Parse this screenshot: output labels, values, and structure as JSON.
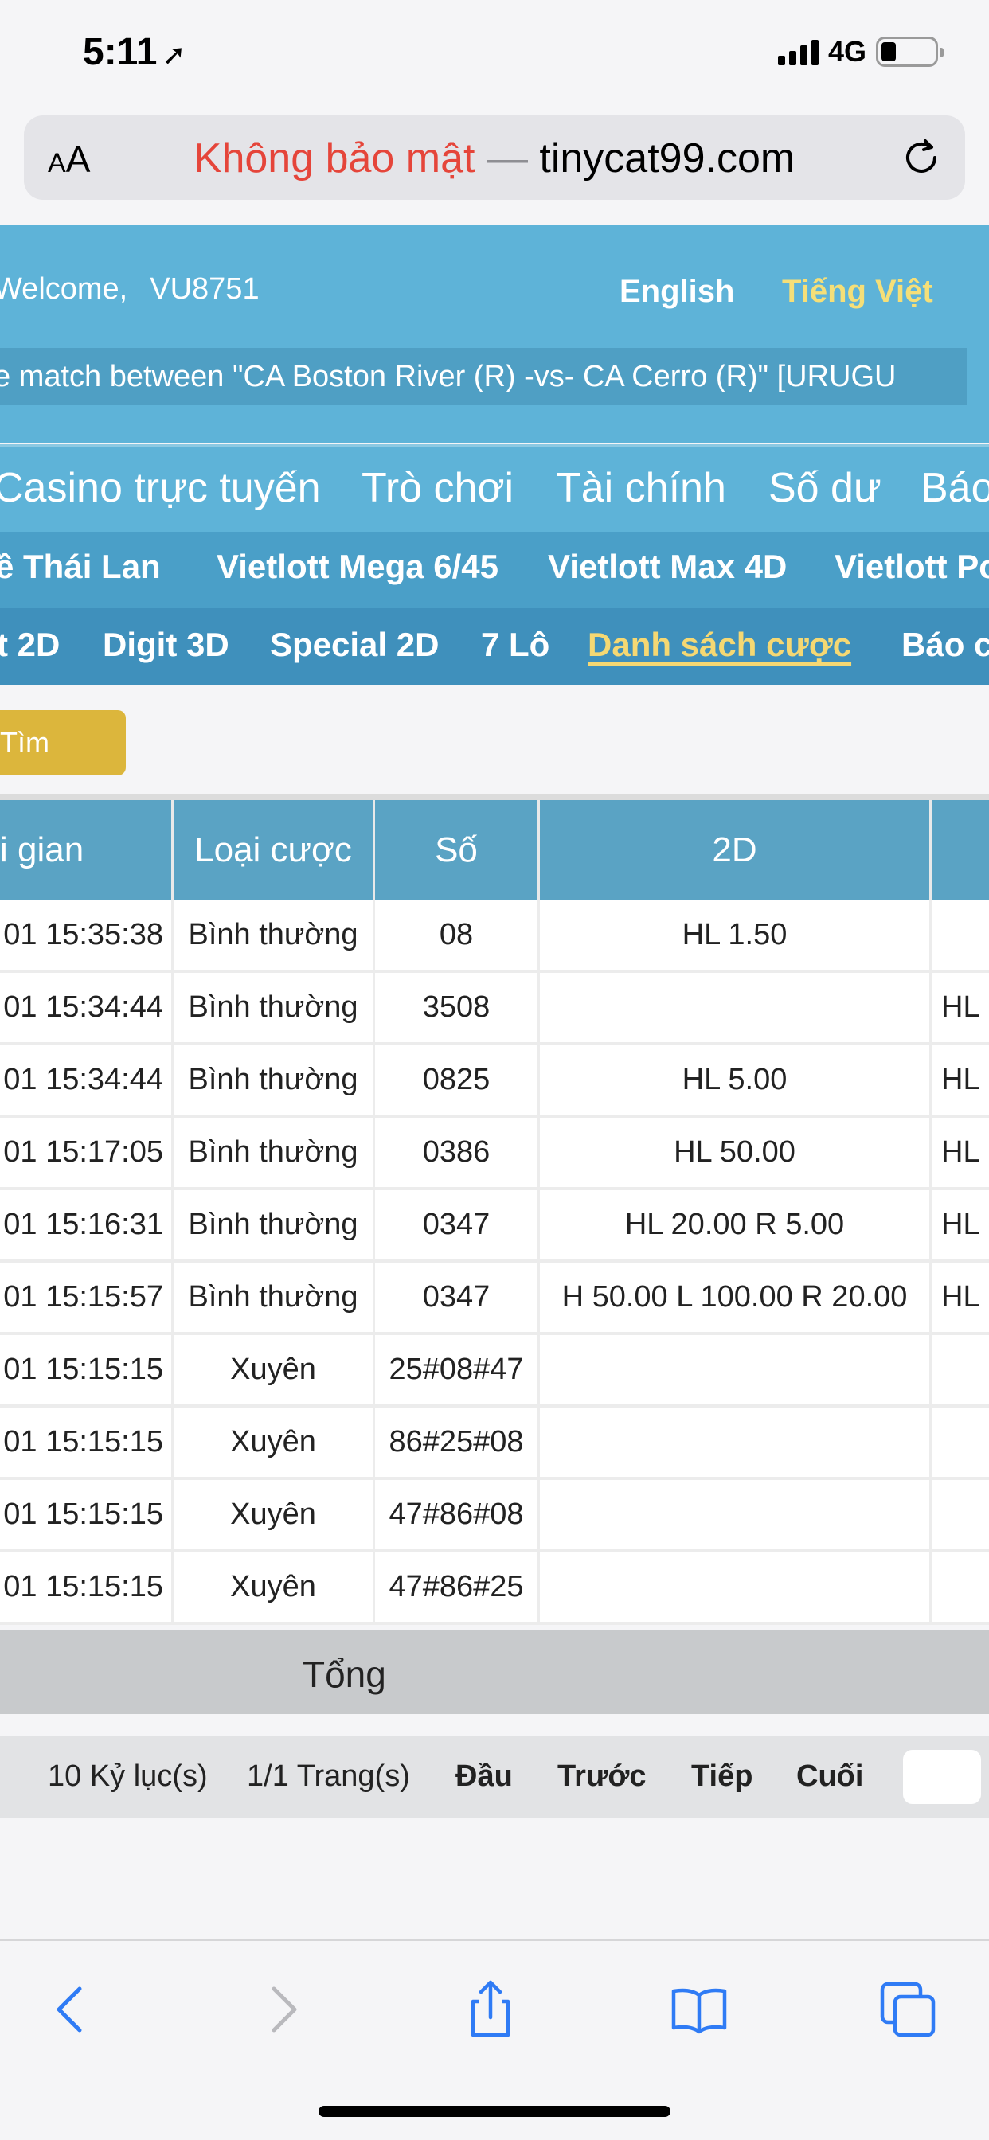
{
  "status_bar": {
    "time": "5:11",
    "network": "4G"
  },
  "browser": {
    "aa_label_small": "A",
    "aa_label_big": "A",
    "url_insecure": "Không bảo mật",
    "url_dash": "—",
    "url_domain": "tinycat99.com"
  },
  "header": {
    "welcome_label": "Welcome,",
    "user_id": "VU8751",
    "lang_en": "English",
    "lang_vi": "Tiếng Việt",
    "marquee": "e match between \"CA Boston River (R) -vs- CA Cerro (R)\" [URUGU"
  },
  "menu_main": [
    "Casino trực tuyến",
    "Trò chơi",
    "Tài chính",
    "Số dư",
    "Báo"
  ],
  "menu_lottery": [
    "ề Thái Lan",
    "Vietlott Mega 6/45",
    "Vietlott Max 4D",
    "Vietlott Po"
  ],
  "menu_sub": [
    "t 2D",
    "Digit 3D",
    "Special 2D",
    "7 Lô",
    "Danh sách cược",
    "Báo c"
  ],
  "search_button": "Tìm",
  "table": {
    "headers": [
      "i gian",
      "Loại cược",
      "Số",
      "2D",
      ""
    ],
    "rows": [
      {
        "time": "01 15:35:38",
        "type": "Bình thường",
        "number": "08",
        "d2": "HL 1.50",
        "extra": ""
      },
      {
        "time": "01 15:34:44",
        "type": "Bình thường",
        "number": "3508",
        "d2": "",
        "extra": "HL"
      },
      {
        "time": "01 15:34:44",
        "type": "Bình thường",
        "number": "0825",
        "d2": "HL 5.00",
        "extra": "HL"
      },
      {
        "time": "01 15:17:05",
        "type": "Bình thường",
        "number": "0386",
        "d2": "HL 50.00",
        "extra": "HL"
      },
      {
        "time": "01 15:16:31",
        "type": "Bình thường",
        "number": "0347",
        "d2": "HL 20.00 R 5.00",
        "extra": "HL"
      },
      {
        "time": "01 15:15:57",
        "type": "Bình thường",
        "number": "0347",
        "d2": "H 50.00 L 100.00 R 20.00",
        "extra": "HL"
      },
      {
        "time": "01 15:15:15",
        "type": "Xuyên",
        "number": "25#08#47",
        "d2": "",
        "extra": ""
      },
      {
        "time": "01 15:15:15",
        "type": "Xuyên",
        "number": "86#25#08",
        "d2": "",
        "extra": ""
      },
      {
        "time": "01 15:15:15",
        "type": "Xuyên",
        "number": "47#86#08",
        "d2": "",
        "extra": ""
      },
      {
        "time": "01 15:15:15",
        "type": "Xuyên",
        "number": "47#86#25",
        "d2": "",
        "extra": ""
      }
    ],
    "total_label": "Tổng"
  },
  "pager": {
    "records": "10 Kỷ lục(s)",
    "pages": "1/1 Trang(s)",
    "first": "Đầu",
    "prev": "Trước",
    "next": "Tiếp",
    "last": "Cuối"
  },
  "colors": {
    "header_blue": "#5eb3d8",
    "insecure_red": "#e5453a",
    "active_yellow": "#f5d873",
    "search_gold": "#dcb63c",
    "toolbar_blue": "#2f7bf5"
  }
}
